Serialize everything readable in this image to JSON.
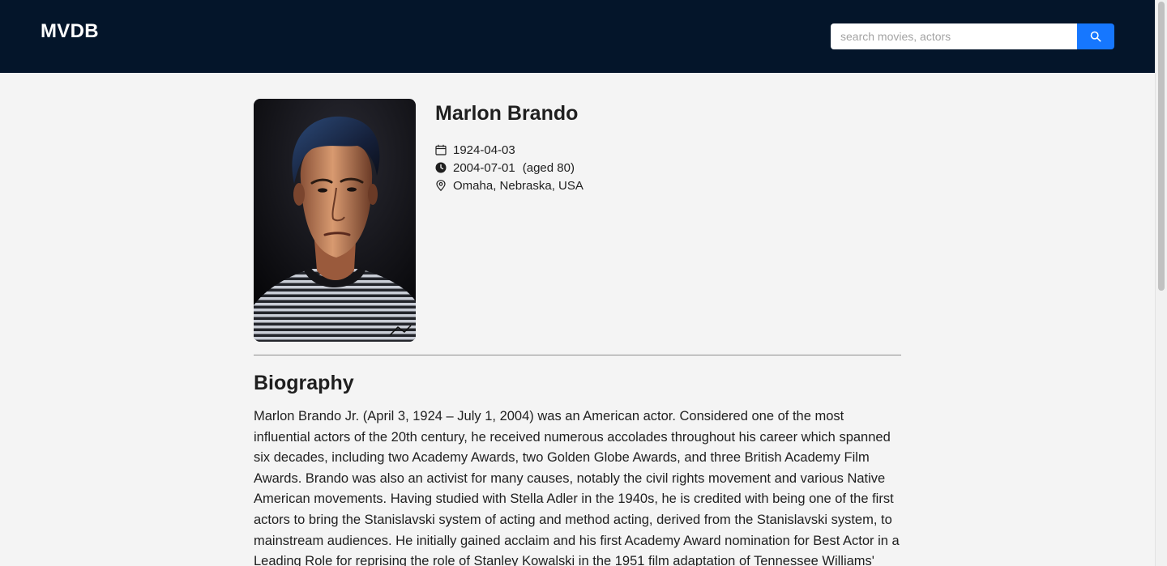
{
  "header": {
    "logo": "MVDB",
    "search_placeholder": "search movies, actors",
    "search_value": ""
  },
  "person": {
    "name": "Marlon Brando",
    "birth_date": "1924-04-03",
    "death_date": "2004-07-01",
    "age_at_death": "(aged 80)",
    "birthplace": "Omaha, Nebraska, USA",
    "icons": {
      "birth": "calendar-icon",
      "death": "clock-icon",
      "place": "location-pin-icon"
    }
  },
  "biography": {
    "heading": "Biography",
    "text": "Marlon Brando Jr. (April 3, 1924 – July 1, 2004) was an American actor. Considered one of the most influential actors of the 20th century, he received numerous accolades throughout his career which spanned six decades, including two Academy Awards, two Golden Globe Awards, and three British Academy Film Awards. Brando was also an activist for many causes, notably the civil rights movement and various Native American movements. Having studied with Stella Adler in the 1940s, he is credited with being one of the first actors to bring the Stanislavski system of acting and method acting, derived from the Stanislavski system, to mainstream audiences. He initially gained acclaim and his first Academy Award nomination for Best Actor in a Leading Role for reprising the role of Stanley Kowalski in the 1951 film adaptation of Tennessee Williams' play A"
  },
  "colors": {
    "header_bg": "#04152a",
    "accent": "#1677ff",
    "page_bg": "#f4f4f4"
  }
}
